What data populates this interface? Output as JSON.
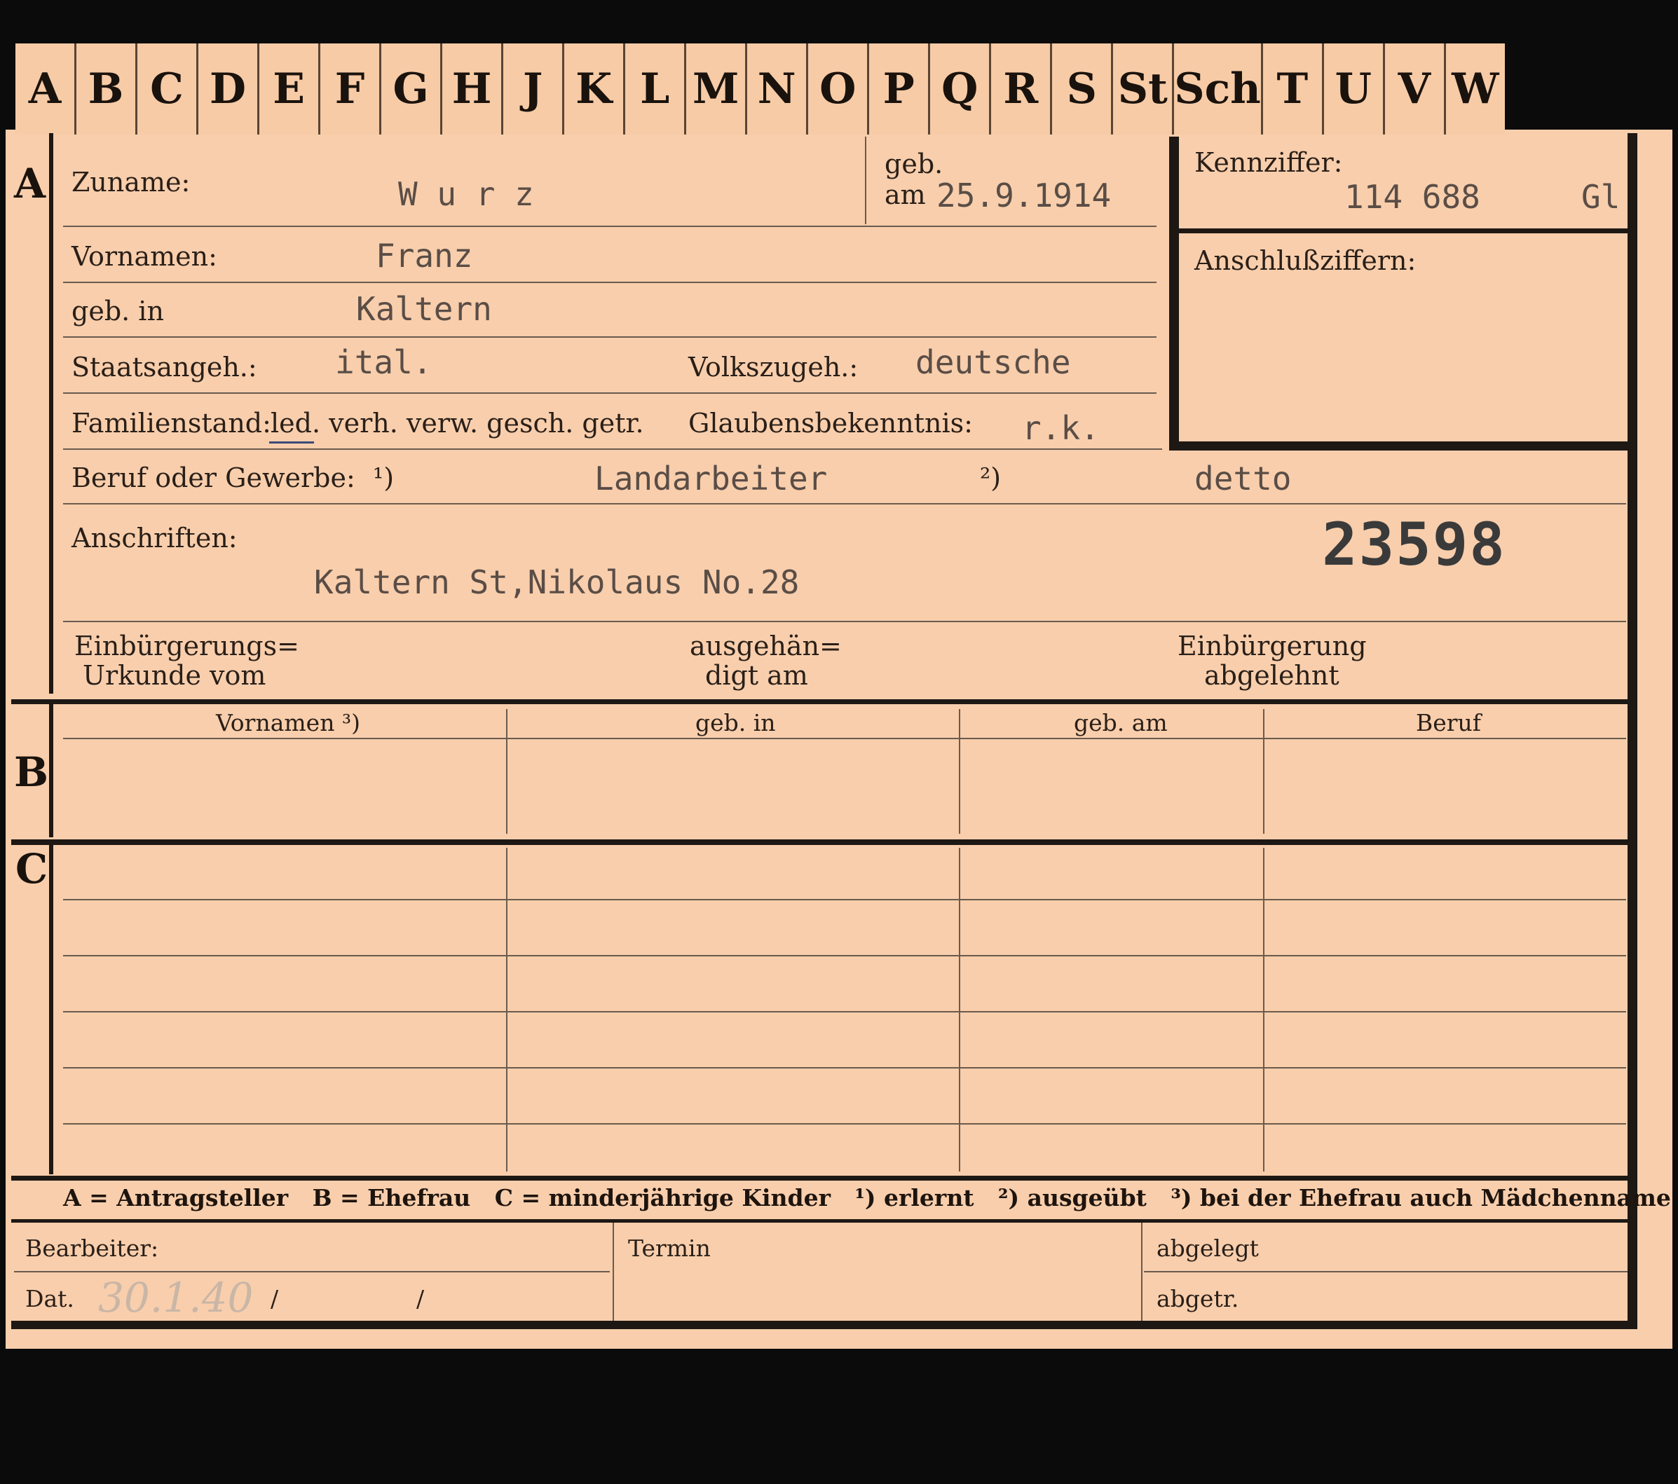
{
  "alphabet_tabs": [
    "A",
    "B",
    "C",
    "D",
    "E",
    "F",
    "G",
    "H",
    "J",
    "K",
    "L",
    "M",
    "N",
    "O",
    "P",
    "Q",
    "R",
    "S",
    "St",
    "Sch",
    "T",
    "U",
    "V",
    "W"
  ],
  "sections": {
    "a": "A",
    "b": "B",
    "c": "C"
  },
  "header": {
    "zuname_label": "Zuname:",
    "zuname_value": "W u r z",
    "geb_label_1": "geb.",
    "geb_label_2": "am",
    "geb_am_value": "25.9.1914",
    "kennziffer_label": "Kennziffer:",
    "kennziffer_value": "114 688",
    "kennziffer_suffix": "Gl",
    "anschluss_label": "Anschlußziffern:"
  },
  "fields": {
    "vornamen_label": "Vornamen:",
    "vornamen_value": "Franz",
    "geb_in_label": "geb. in",
    "geb_in_value": "Kaltern",
    "staatsangeh_label": "Staatsangeh.:",
    "staatsangeh_value": "ital.",
    "volkszugeh_label": "Volkszugeh.:",
    "volkszugeh_value": "deutsche",
    "familienstand_label": "Familienstand:",
    "familienstand_options": "led. verh. verw. gesch. getr.",
    "glauben_label": "Glaubensbekenntnis:",
    "glauben_value": "r.k.",
    "beruf_label": "Beruf oder Gewerbe:",
    "beruf_mark1": "¹)",
    "beruf_value1": "Landarbeiter",
    "beruf_mark2": "²)",
    "beruf_value2": "detto",
    "anschriften_label": "Anschriften:",
    "anschriften_value": "Kaltern St,Nikolaus No.28",
    "stamp_number": "23598",
    "einb_urkunde_1": "Einbürgerungs=",
    "einb_urkunde_2": "Urkunde vom",
    "ausgehaendigt_1": "ausgehän=",
    "ausgehaendigt_2": "digt am",
    "einb_abgelehnt_1": "Einbürgerung",
    "einb_abgelehnt_2": "abgelehnt"
  },
  "table_headers": [
    "Vornamen ³)",
    "geb. in",
    "geb. am",
    "Beruf"
  ],
  "legend": "A = Antragsteller   B = Ehefrau   C = minderjährige Kinder   ¹) erlernt   ²) ausgeübt   ³) bei der Ehefrau auch Mädchenname",
  "footer": {
    "bearbeiter_label": "Bearbeiter:",
    "dat_label": "Dat.",
    "dat_value": "30.1.40",
    "slash1": "/",
    "slash2": "/",
    "termin_label": "Termin",
    "abgelegt_label": "abgelegt",
    "abgetr_label": "abgetr."
  }
}
